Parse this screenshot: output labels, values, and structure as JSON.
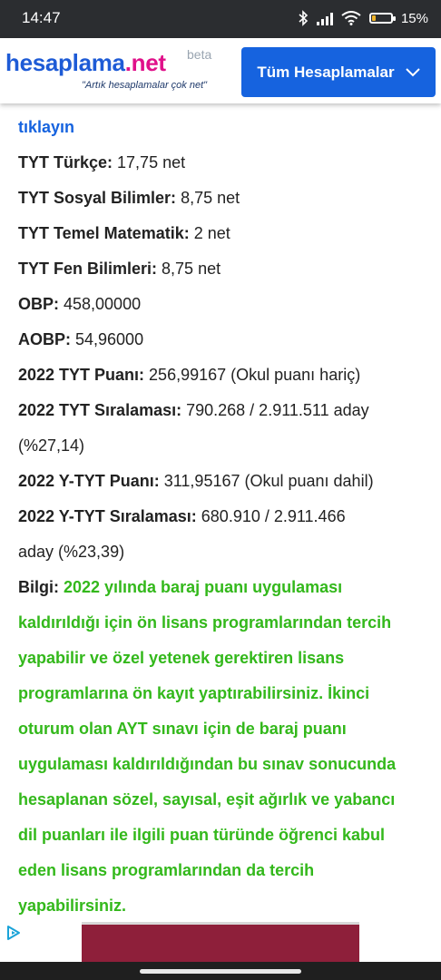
{
  "status_bar": {
    "time": "14:47",
    "battery": "15%"
  },
  "header": {
    "logo_part1": "hesaplama",
    "logo_part2": ".net",
    "beta": "beta",
    "slogan": "\"Artık hesaplamalar çok net\"",
    "menu_button": "Tüm Hesaplamalar"
  },
  "content": {
    "link": "tıklayın",
    "rows": [
      {
        "key": "TYT Türkçe:",
        "value": " 17,75 net"
      },
      {
        "key": "TYT Sosyal Bilimler:",
        "value": " 8,75 net"
      },
      {
        "key": "TYT Temel Matematik:",
        "value": " 2 net"
      },
      {
        "key": "TYT Fen Bilimleri:",
        "value": " 8,75 net"
      },
      {
        "key": "OBP:",
        "value": " 458,00000"
      },
      {
        "key": "AOBP:",
        "value": " 54,96000"
      },
      {
        "key": "2022 TYT Puanı:",
        "value": " 256,99167 (Okul puanı hariç)"
      },
      {
        "key": "2022 TYT Sıralaması:",
        "value": " 790.268 / 2.911.511 aday",
        "cont": "(%27,14)"
      },
      {
        "key": "2022 Y-TYT Puanı:",
        "value": " 311,95167 (Okul puanı dahil)"
      },
      {
        "key": "2022 Y-TYT Sıralaması:",
        "value": " 680.910 / 2.911.466",
        "cont": "aday (%23,39)"
      }
    ],
    "info_label": "Bilgi:",
    "info_lines": [
      " 2022 yılında baraj puanı uygulaması",
      "kaldırıldığı için ön lisans programlarından tercih",
      "yapabilir ve özel yetenek gerektiren lisans",
      "programlarına ön kayıt yaptırabilirsiniz. İkinci",
      "oturum olan AYT sınavı için de baraj puanı",
      "uygulaması kaldırıldığından bu sınav sonucunda",
      "hesaplanan sözel, sayısal, eşit ağırlık ve yabancı",
      "dil puanları ile ilgili puan türünde öğrenci kabul",
      "eden lisans programlarından da tercih",
      "yapabilirsiniz."
    ]
  },
  "icons": {
    "ad": "adchoices-icon",
    "menu_chevron": "chevron-down-icon"
  },
  "colors": {
    "brand_blue": "#1663df",
    "brand_pink": "#e0118a",
    "info_green": "#33b81b",
    "ad": "#8e1f3a"
  }
}
